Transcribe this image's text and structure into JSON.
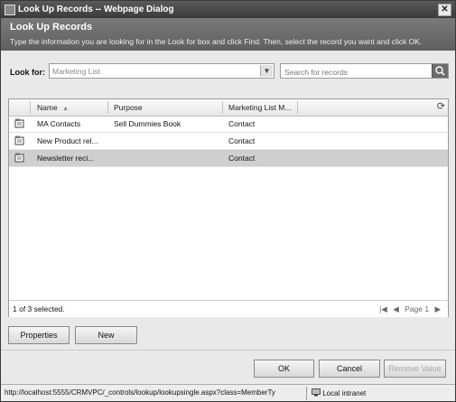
{
  "window": {
    "title": "Look Up Records -- Webpage Dialog",
    "close_glyph": "✕"
  },
  "header": {
    "title": "Look Up Records",
    "description": "Type the information you are looking for in the Look for box and click Find. Then, select the record you want and click OK."
  },
  "lookfor": {
    "label": "Look for:",
    "selected": "Marketing List",
    "search_placeholder": "Search for records"
  },
  "grid": {
    "columns": [
      "Name",
      "Purpose",
      "Marketing List M..."
    ],
    "sort_glyph": "▲",
    "rows": [
      {
        "name": "MA Contacts",
        "purpose": "Sell Dummies Book",
        "member_type": "Contact",
        "selected": false
      },
      {
        "name": "New Product rel...",
        "purpose": "",
        "member_type": "Contact",
        "selected": false
      },
      {
        "name": "Newsletter reci...",
        "purpose": "",
        "member_type": "Contact",
        "selected": true
      }
    ],
    "selection_status": "1 of 3 selected.",
    "page_label": "Page 1"
  },
  "buttons": {
    "properties": "Properties",
    "new": "New",
    "ok": "OK",
    "cancel": "Cancel",
    "remove_value": "Remove Value"
  },
  "statusbar": {
    "url": "http://localhost:5555/CRMVPC/_controls/lookup/lookupsingle.aspx?class=MemberTy",
    "zone": "Local intranet"
  }
}
